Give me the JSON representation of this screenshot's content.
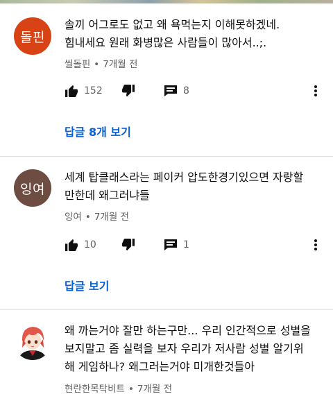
{
  "comments": [
    {
      "avatar_text": "돌핀",
      "avatar_color": "#d84315",
      "line1": "솔끼 어그로도 없고 왜 욕먹는지 이해못하겠네.",
      "line2": "힘내세요 원래 화병많은 사람들이 많아서..;.",
      "author": "씰돌핀",
      "time": "7개월 전",
      "likes": "152",
      "replies": "8",
      "replies_link": "답글 8개 보기"
    },
    {
      "avatar_text": "잉여",
      "avatar_color": "#6d4c41",
      "line1": "세계 탑클래스라는 페이커 압도한경기있으면 자랑할",
      "line2": "만한데 왜그러냐들",
      "author": "잉여",
      "time": "7개월 전",
      "likes": "10",
      "replies": "1",
      "replies_link": "답글 보기"
    },
    {
      "line1": "왜 까는거야 잘만 하는구만... 우리 인간적으로 성별을",
      "line2": "보지말고 좀 실력을 보자 우리가 저사람 성별 알기위",
      "line3": "해 게임하나? 왜그러는거야 미개한것들아",
      "author": "현란한목탁비트",
      "time": "7개월 전"
    }
  ],
  "separator": "•",
  "icons": {
    "like": "thumbs-up-icon",
    "dislike": "thumbs-down-icon",
    "reply": "comment-icon",
    "more": "more-vertical-icon"
  },
  "colors": {
    "link": "#065fd4",
    "meta": "#606060",
    "text": "#0f0f0f"
  }
}
